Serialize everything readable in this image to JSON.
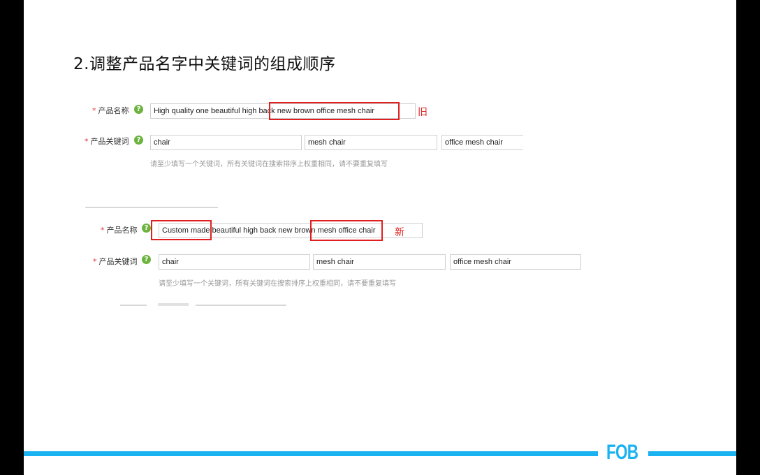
{
  "slide": {
    "title": "2.调整产品名字中关键词的组成顺序",
    "logo_text": "FOB"
  },
  "old_form": {
    "name_label": "产品名称",
    "name_value": "High quality one beautiful high back new brown office mesh chair",
    "tag": "旧",
    "keywords_label": "产品关键词",
    "keywords": [
      "chair",
      "mesh chair",
      "office mesh chair"
    ],
    "hint": "请至少填写一个关键词，所有关键词在搜索排序上权重相同，请不要重复填写"
  },
  "new_form": {
    "name_label": "产品名称",
    "name_value": "Custom made beautiful high back new brown mesh office chair",
    "tag": "新",
    "keywords_label": "产品关键词",
    "keywords": [
      "chair",
      "mesh chair",
      "office mesh chair"
    ],
    "hint": "请至少填写一个关键词，所有关键词在搜索排序上权重相同，请不要重复填写"
  },
  "help_icon_glyph": "?",
  "required_mark": "*",
  "colors": {
    "accent": "#1ab2f0",
    "highlight": "#e02020",
    "help": "#6cb33f"
  }
}
